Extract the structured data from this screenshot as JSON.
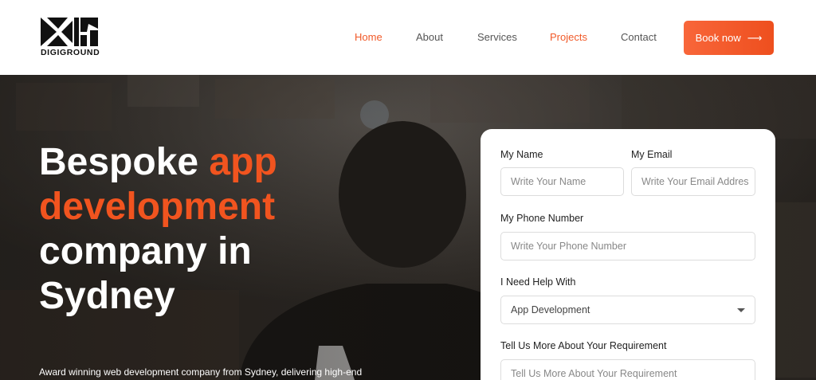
{
  "brand": {
    "name": "DIGIGROUND",
    "icon": "dk-logo-icon"
  },
  "nav": {
    "items": [
      {
        "label": "Home",
        "active": true
      },
      {
        "label": "About",
        "active": false
      },
      {
        "label": "Services",
        "active": false
      },
      {
        "label": "Projects",
        "active": true
      },
      {
        "label": "Contact",
        "active": false
      }
    ],
    "cta_label": "Book now",
    "cta_icon": "arrow-right-icon"
  },
  "hero": {
    "title_part1": "Bespoke ",
    "title_accent1": "app",
    "title_accent2": "development",
    "title_part2": "company in",
    "title_part3": "Sydney",
    "subtitle": "Award winning web development company from Sydney, delivering high-end"
  },
  "form": {
    "name_label": "My Name",
    "name_placeholder": "Write Your Name",
    "email_label": "My Email",
    "email_placeholder": "Write Your Email Addres",
    "phone_label": "My Phone Number",
    "phone_placeholder": "Write Your Phone Number",
    "help_label": "I Need Help With",
    "help_selected": "App Development",
    "requirement_label": "Tell Us More About Your Requirement",
    "requirement_placeholder": "Tell Us More About Your Requirement"
  },
  "colors": {
    "accent": "#f15a29",
    "nav_text": "#555555",
    "hero_bg": "#2b2723"
  }
}
